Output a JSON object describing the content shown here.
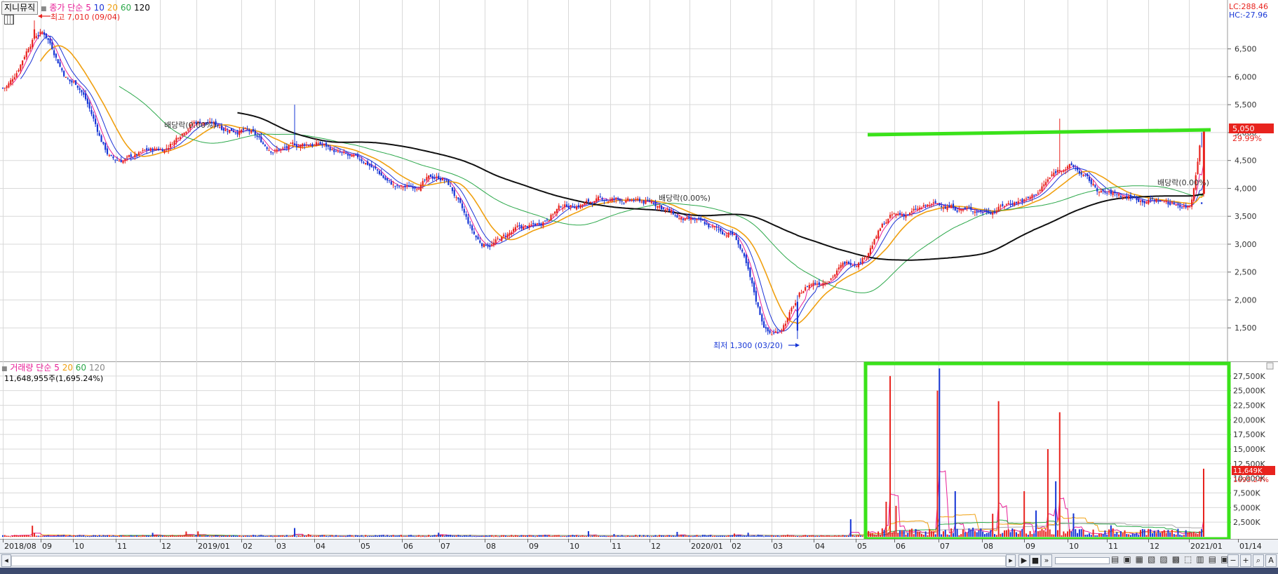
{
  "header": {
    "stock_name": "지니뮤직",
    "price_legend": {
      "label": "종가",
      "ma_kind": "단순",
      "periods": [
        "5",
        "10",
        "20",
        "60",
        "120"
      ]
    },
    "volume_legend": {
      "label": "거래량",
      "ma_kind": "단순",
      "periods": [
        "5",
        "20",
        "60",
        "120"
      ]
    },
    "volume_value_text": "11,648,955주(1,695.24%)",
    "lc_text": "LC:288.46",
    "hc_text": "HC:-27.96"
  },
  "annotations": {
    "high": "최고 7,010 (09/04)",
    "low": "최저 1,300 (03/20)",
    "dividend_1": "배당락(0.00%)",
    "dividend_2": "배당락(0.00%)",
    "dividend_3": "배당락(0.00%)"
  },
  "price_axis": {
    "ticks": [
      "6,500",
      "6,000",
      "5,500",
      "5,000",
      "4,500",
      "4,000",
      "3,500",
      "3,000",
      "2,500",
      "2,000",
      "1,500"
    ],
    "current_price": "5,050",
    "current_change": "29.99%"
  },
  "volume_axis": {
    "ticks": [
      "27,500K",
      "25,000K",
      "22,500K",
      "20,000K",
      "17,500K",
      "15,000K",
      "12,500K",
      "10,000K",
      "7,500K",
      "5,000K",
      "2,500K"
    ],
    "current_volume": "11,649K",
    "current_change": "1695.24%"
  },
  "x_axis": {
    "labels": [
      "2018/08",
      "09",
      "10",
      "11",
      "12",
      "2019/01",
      "02",
      "03",
      "04",
      "05",
      "06",
      "07",
      "08",
      "09",
      "10",
      "11",
      "12",
      "2020/01",
      "02",
      "03",
      "04",
      "05",
      "06",
      "07",
      "08",
      "09",
      "10",
      "11",
      "12",
      "2021/01",
      "01/14"
    ]
  },
  "toolbar": {
    "icons": [
      "left-arrow-icon",
      "right-arrow-icon",
      "play-icon",
      "stop-icon",
      "fast-forward-icon",
      "zoom-in-icon",
      "zoom-out-icon",
      "text-size-icon"
    ]
  },
  "colors": {
    "up": "#e8231e",
    "down": "#1636d6",
    "ma5": "#e81e96",
    "ma10": "#1c33d6",
    "ma20": "#f0a010",
    "ma60": "#2ba84a",
    "ma120": "#111111",
    "highlight": "#3ae21a",
    "grid": "#d9d9d9"
  },
  "chart_data": {
    "type": "candlestick",
    "price_ylim": [
      1000,
      7200
    ],
    "volume_ylim": [
      0,
      30000
    ],
    "volume_unit": "K",
    "anchors": [
      {
        "date": "2018/08",
        "close": 5800
      },
      {
        "date": "2018/09",
        "close": 6800
      },
      {
        "date": "2018/10",
        "close": 5900
      },
      {
        "date": "2018/11",
        "close": 4500
      },
      {
        "date": "2018/12",
        "close": 4700
      },
      {
        "date": "2019/01",
        "close": 5200
      },
      {
        "date": "2019/02",
        "close": 5050
      },
      {
        "date": "2019/03",
        "close": 4700
      },
      {
        "date": "2019/04",
        "close": 4800
      },
      {
        "date": "2019/05",
        "close": 4500
      },
      {
        "date": "2019/06",
        "close": 4000
      },
      {
        "date": "2019/07",
        "close": 4200
      },
      {
        "date": "2019/08",
        "close": 3000
      },
      {
        "date": "2019/09",
        "close": 3300
      },
      {
        "date": "2019/10",
        "close": 3700
      },
      {
        "date": "2019/11",
        "close": 3800
      },
      {
        "date": "2019/12",
        "close": 3750
      },
      {
        "date": "2020/01",
        "close": 3400
      },
      {
        "date": "2020/02",
        "close": 3200
      },
      {
        "date": "2020/03",
        "close": 1400
      },
      {
        "date": "2020/04",
        "close": 2300
      },
      {
        "date": "2020/05",
        "close": 2700
      },
      {
        "date": "2020/06",
        "close": 3500
      },
      {
        "date": "2020/07",
        "close": 3700
      },
      {
        "date": "2020/08",
        "close": 3600
      },
      {
        "date": "2020/09",
        "close": 3800
      },
      {
        "date": "2020/10",
        "close": 4400
      },
      {
        "date": "2020/11",
        "close": 3900
      },
      {
        "date": "2020/12",
        "close": 3800
      },
      {
        "date": "2021/01",
        "close": 3700
      },
      {
        "date": "2021/01/14",
        "close": 5050
      }
    ],
    "high": {
      "value": 7010,
      "date": "09/04"
    },
    "low": {
      "value": 1300,
      "date": "03/20"
    },
    "last_close": 5050,
    "last_volume_k": 11649,
    "volume_spikes_k": [
      {
        "date": "2020/06",
        "value": 27500
      },
      {
        "date": "2020/07",
        "value": 28800
      },
      {
        "date": "2020/08",
        "value": 23200
      },
      {
        "date": "2020/09",
        "value": 15000
      },
      {
        "date": "2020/09",
        "value": 21300
      },
      {
        "date": "2021/01/14",
        "value": 11649
      }
    ],
    "resistance_level": 5050
  }
}
